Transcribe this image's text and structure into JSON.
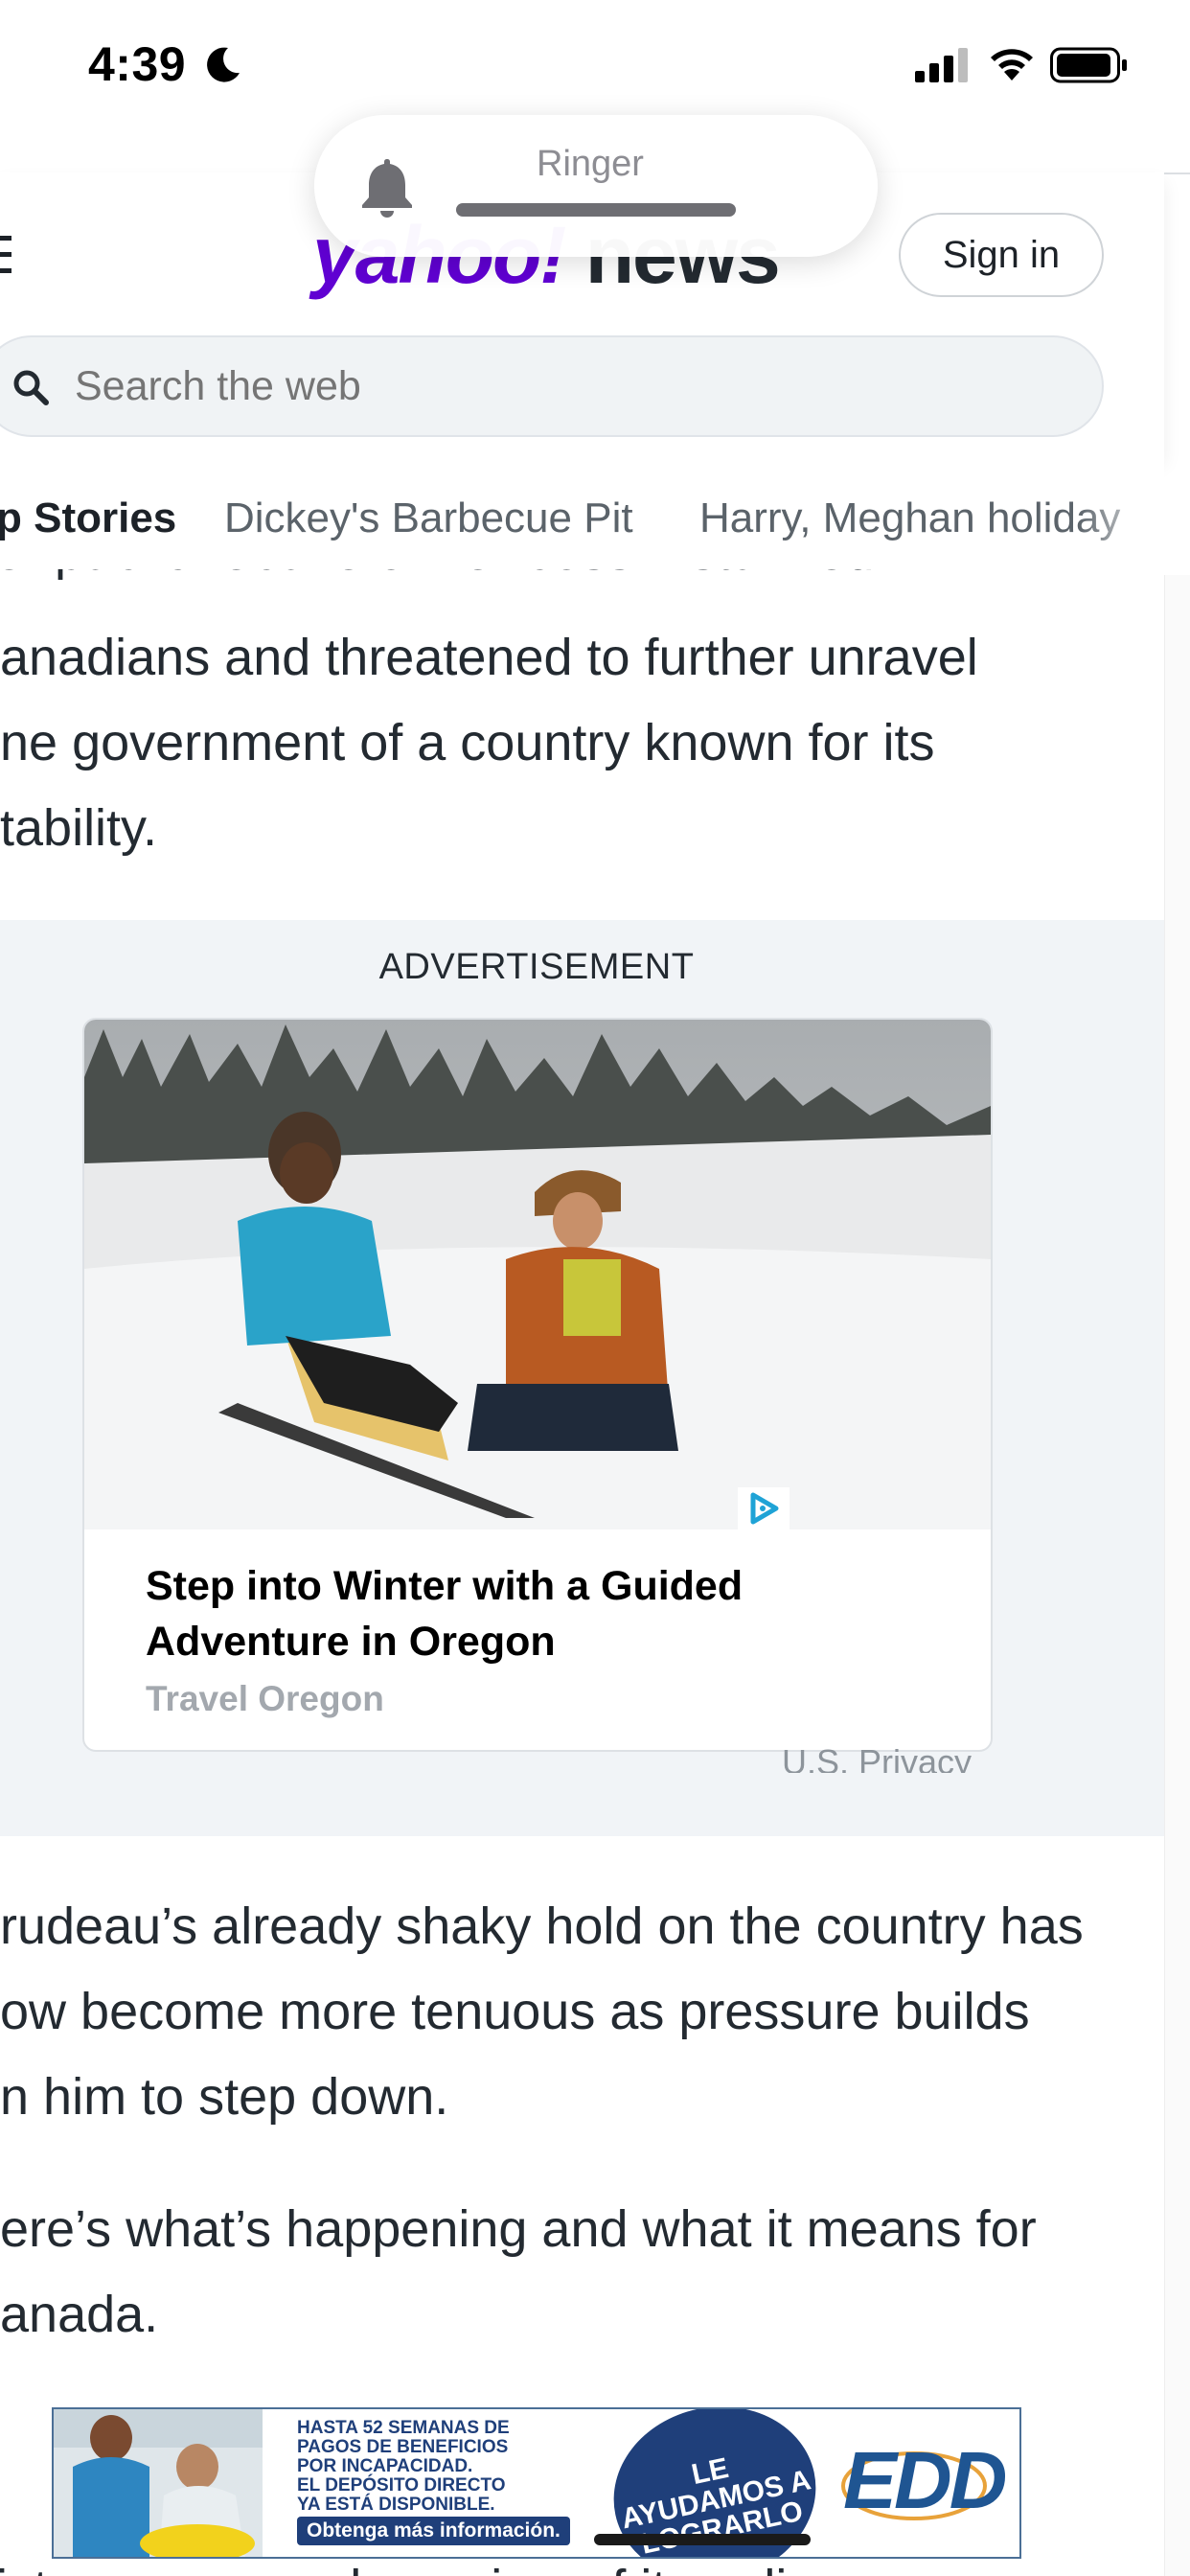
{
  "status_bar": {
    "time": "4:39",
    "icons": [
      "moon-icon",
      "signal-icon",
      "wifi-icon",
      "battery-icon"
    ]
  },
  "ringer": {
    "label": "Ringer",
    "icon": "bell-icon"
  },
  "header": {
    "logo_yahoo": "yahoo!",
    "logo_news": "news",
    "signin_label": "Sign in",
    "search_placeholder": "Search the web",
    "brand_color": "#6001d2"
  },
  "tabs": [
    {
      "label": "Top Stories",
      "visible_text": "p Stories",
      "active": true
    },
    {
      "label": "Dickey's Barbecue Pit",
      "active": false
    },
    {
      "label": "Harry, Meghan holiday",
      "active": false
    }
  ],
  "article": {
    "top_cut_line": "er public rebuke of her boss – stunned",
    "paragraph1_lines": [
      "anadians and threatened to further unravel",
      "ne government of a country known for its",
      "tability."
    ],
    "paragraph2_lines": [
      "rudeau’s already shaky hold on the country has",
      "ow become more tenuous as pressure builds",
      "n him to step down."
    ],
    "paragraph3_lines": [
      "ere’s what’s happening and what it means for",
      "anada."
    ],
    "bottom_cut_line": "istry announced a review of its policy on"
  },
  "ad": {
    "label": "ADVERTISEMENT",
    "title": "Step into Winter with a Guided Adventure in Oregon",
    "sponsor": "Travel Oregon",
    "privacy": "U.S. Privacy",
    "adchoices_icon": "adchoices-icon"
  },
  "banner": {
    "lines": [
      "HASTA 52 SEMANAS DE",
      "PAGOS DE BENEFICIOS",
      "POR INCAPACIDAD.",
      "EL DEPÓSITO DIRECTO",
      "YA ESTÁ DISPONIBLE."
    ],
    "cta": "Obtenga más información.",
    "circle_text": "LE AYUDAMOS A LOGRARLO",
    "logo": "EDD"
  }
}
